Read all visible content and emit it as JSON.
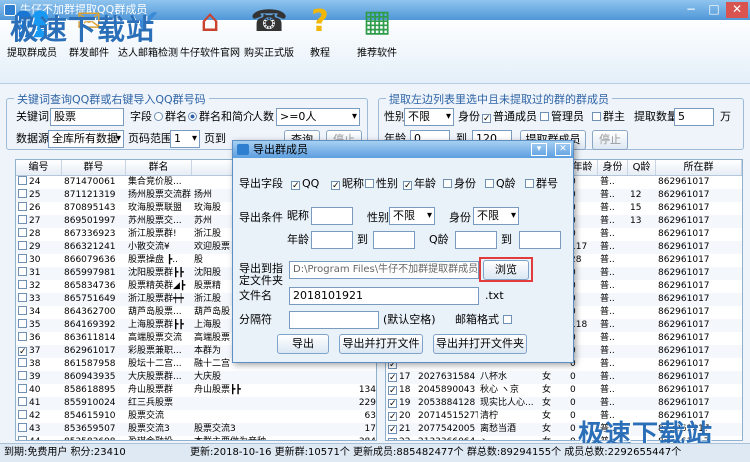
{
  "window": {
    "title": "牛仔不加群提取QQ群成员",
    "min": "−",
    "max": "□",
    "close": "✕"
  },
  "toolbar": {
    "items": [
      {
        "label": "提取群成员",
        "icon": "people-icon"
      },
      {
        "label": "群发邮件",
        "icon": "mail-icon"
      },
      {
        "label": "达人邮箱检测",
        "icon": "mail-check-icon"
      },
      {
        "label": "牛仔软件官网",
        "icon": "home-icon"
      },
      {
        "label": "购买正式版",
        "icon": "headset-icon"
      },
      {
        "label": "教程",
        "icon": "help-icon"
      },
      {
        "label": "推荐软件",
        "icon": "grid-icon"
      }
    ],
    "watermark": "极速下载站"
  },
  "search": {
    "title": "关键词查询QQ群或右键导入QQ群号码",
    "keyword_label": "关键词",
    "keyword_value": "股票",
    "field_label": "字段",
    "opt_name": "群名",
    "opt_name_intro": "群名和简介",
    "members_label": "人数",
    "members_value": ">=0人",
    "source_label": "数据源",
    "source_value": "全库所有数据",
    "page_label": "页码范围",
    "page_from": "1",
    "page_to_label": "页到",
    "search_btn": "查询",
    "stop_btn": "停止"
  },
  "extract": {
    "title": "提取左边列表里选中且未提取过的群的群成员",
    "gender_label": "性别",
    "gender_value": "不限",
    "identity_label": "身份",
    "normal": "普通成员",
    "admin": "管理员",
    "owner": "群主",
    "count_label": "提取数量",
    "count_value": "5",
    "unit": "万",
    "age_label": "年龄",
    "age_from": "0",
    "age_to_label": "到",
    "age_to": "120",
    "start_btn": "提取群成员",
    "stop_btn": "停止"
  },
  "left_table": {
    "headers": [
      "编号",
      "群号",
      "群名",
      "",
      "人数"
    ],
    "rows": [
      {
        "no": "24",
        "id": "871470061",
        "name": "集合竞价股...",
        "name2": "",
        "n": ""
      },
      {
        "no": "25",
        "id": "871121319",
        "name": "扬州股票交流群",
        "name2": "扬州",
        "n": ""
      },
      {
        "no": "26",
        "id": "870895143",
        "name": "玫海股票联盟",
        "name2": "玫海股",
        "n": ""
      },
      {
        "no": "27",
        "id": "869501997",
        "name": "苏州股票交...",
        "name2": "苏州",
        "n": ""
      },
      {
        "no": "28",
        "id": "867336923",
        "name": "浙江股票群!",
        "name2": "浙江股",
        "n": ""
      },
      {
        "no": "29",
        "id": "866321241",
        "name": "小散交流¥",
        "name2": "欢迎股票",
        "n": ""
      },
      {
        "no": "30",
        "id": "866079636",
        "name": "股票操盘 ┣..",
        "name2": "股",
        "n": ""
      },
      {
        "no": "31",
        "id": "865997981",
        "name": "沈阳股票群┣┣",
        "name2": "沈阳股",
        "n": ""
      },
      {
        "no": "32",
        "id": "865834736",
        "name": "股票精英群◢┣",
        "name2": "股票精",
        "n": ""
      },
      {
        "no": "33",
        "id": "865751649",
        "name": "浙江股票群┿┿",
        "name2": "浙江股",
        "n": ""
      },
      {
        "no": "34",
        "id": "864362700",
        "name": "葫芦岛股票...",
        "name2": "葫芦岛股",
        "n": ""
      },
      {
        "no": "35",
        "id": "864169392",
        "name": "上海股票群┣┣",
        "name2": "上海股",
        "n": ""
      },
      {
        "no": "36",
        "id": "863611814",
        "name": "高端股票交流",
        "name2": "高端股票",
        "n": ""
      },
      {
        "no": "37",
        "id": "862961017",
        "name": "彩股票兼职...",
        "name2": "本群为",
        "n": "",
        "checked": true
      },
      {
        "no": "38",
        "id": "861587958",
        "name": "股坛十二宫...",
        "name2": "融十二宫",
        "n": ""
      },
      {
        "no": "39",
        "id": "860943935",
        "name": "大庆股票群...",
        "name2": "大庆股",
        "n": ""
      },
      {
        "no": "40",
        "id": "858618895",
        "name": "舟山股票群",
        "name2": "舟山股票┣┣",
        "n": "134"
      },
      {
        "no": "41",
        "id": "855910024",
        "name": "红三兵股票",
        "name2": "",
        "n": "229"
      },
      {
        "no": "42",
        "id": "854615910",
        "name": "股票交流",
        "name2": "",
        "n": "63"
      },
      {
        "no": "43",
        "id": "853659507",
        "name": "股票交流3",
        "name2": "股票交流3",
        "n": "17"
      },
      {
        "no": "44",
        "id": "852583698",
        "name": "盈琪金融投...",
        "name2": "本群主要做为音种...",
        "n": "384"
      },
      {
        "no": "45",
        "id": "852333477",
        "name": "股票散户集...",
        "name2": "",
        "n": "88"
      }
    ]
  },
  "right_table": {
    "headers": [
      "",
      "QQ",
      "昵称",
      "性别",
      "年龄",
      "身份",
      "Q龄",
      "所在群"
    ],
    "rows": [
      {
        "no": "",
        "qq": "",
        "nick": "",
        "sex": "",
        "age": "0",
        "role": "普..",
        "ql": "",
        "grp": "862961017"
      },
      {
        "no": "",
        "qq": "",
        "nick": "",
        "sex": "",
        "age": "0",
        "role": "普..",
        "ql": "12",
        "grp": "862961017"
      },
      {
        "no": "",
        "qq": "",
        "nick": "",
        "sex": "",
        "age": "0",
        "role": "普..",
        "ql": "15",
        "grp": "862961017"
      },
      {
        "no": "",
        "qq": "",
        "nick": "",
        "sex": "",
        "age": "0",
        "role": "普..",
        "ql": "13",
        "grp": "862961017"
      },
      {
        "no": "",
        "qq": "",
        "nick": "",
        "sex": "",
        "age": "0",
        "role": "普..",
        "ql": "",
        "grp": "862961017"
      },
      {
        "no": "",
        "qq": "",
        "nick": "",
        "sex": "",
        "age": "117",
        "role": "普..",
        "ql": "",
        "grp": "862961017"
      },
      {
        "no": "",
        "qq": "",
        "nick": "",
        "sex": "",
        "age": "28",
        "role": "普..",
        "ql": "",
        "grp": "862961017"
      },
      {
        "no": "",
        "qq": "",
        "nick": "",
        "sex": "",
        "age": "0",
        "role": "普..",
        "ql": "",
        "grp": "862961017"
      },
      {
        "no": "",
        "qq": "",
        "nick": "",
        "sex": "",
        "age": "0",
        "role": "普..",
        "ql": "",
        "grp": "862961017"
      },
      {
        "no": "",
        "qq": "",
        "nick": "",
        "sex": "",
        "age": "0",
        "role": "普..",
        "ql": "",
        "grp": "862961017"
      },
      {
        "no": "",
        "qq": "",
        "nick": "",
        "sex": "",
        "age": "0",
        "role": "普..",
        "ql": "",
        "grp": "862961017"
      },
      {
        "no": "",
        "qq": "",
        "nick": "",
        "sex": "",
        "age": "118",
        "role": "普..",
        "ql": "",
        "grp": "862961017"
      },
      {
        "no": "",
        "qq": "",
        "nick": "",
        "sex": "",
        "age": "0",
        "role": "普..",
        "ql": "",
        "grp": "862961017"
      },
      {
        "no": "",
        "qq": "",
        "nick": "",
        "sex": "",
        "age": "0",
        "role": "普..",
        "ql": "",
        "grp": "862961017"
      },
      {
        "no": "",
        "qq": "",
        "nick": "",
        "sex": "",
        "age": "0",
        "role": "普..",
        "ql": "",
        "grp": "862961017"
      },
      {
        "no": "17",
        "qq": "2027631584",
        "nick": "八杯水",
        "sex": "女",
        "age": "0",
        "role": "普..",
        "ql": "",
        "grp": "862961017"
      },
      {
        "no": "18",
        "qq": "2045890043",
        "nick": "秋心 ヽ京",
        "sex": "女",
        "age": "0",
        "role": "普..",
        "ql": "",
        "grp": "862961017"
      },
      {
        "no": "19",
        "qq": "2053884128",
        "nick": "现实比人心...",
        "sex": "女",
        "age": "0",
        "role": "普..",
        "ql": "",
        "grp": "862961017"
      },
      {
        "no": "20",
        "qq": "2071451527T",
        "nick": "清柠",
        "sex": "女",
        "age": "0",
        "role": "普..",
        "ql": "",
        "grp": "862961017"
      },
      {
        "no": "21",
        "qq": "2077542005",
        "nick": "离愁当酒",
        "sex": "女",
        "age": "0",
        "role": "普..",
        "ql": "",
        "grp": "862961017"
      },
      {
        "no": "22",
        "qq": "2133366064",
        "nick": "丶...",
        "sex": "女",
        "age": "0",
        "role": "普..",
        "ql": "",
        "grp": "862961017"
      }
    ]
  },
  "dialog": {
    "title": "导出群成员",
    "fields_label": "导出字段",
    "f_qq": "QQ",
    "f_nick": "昵称",
    "f_sex": "性别",
    "f_age": "年龄",
    "f_role": "身份",
    "f_ql": "Q龄",
    "f_grp": "群号",
    "cond_label": "导出条件",
    "nick_label": "昵称",
    "sex_label": "性别",
    "sex_value": "不限",
    "role_label": "身份",
    "role_value": "不限",
    "age_label": "年龄",
    "to1": "到",
    "ql_label": "Q龄",
    "to2": "到",
    "path_label": "导出到指定文件夹",
    "path_value": "D:\\Program Files\\牛仔不加群提取群成员\\",
    "browse": "浏览",
    "filename_label": "文件名",
    "filename_value": "2018101921",
    "ext": ".txt",
    "sep_label": "分隔符",
    "sep_hint": "(默认空格)",
    "mail_label": "邮箱格式",
    "btn_export": "导出",
    "btn_export_open_file": "导出并打开文件",
    "btn_export_open_folder": "导出并打开文件夹"
  },
  "status": {
    "text": "到期:免费用户 积分:23410",
    "update": "更新:2018-10-16 更新群:10571个 更新成员:885482477个 群总数:89294155个 成员总数:2292655447个"
  },
  "colors": {
    "accent": "#2f64a6",
    "highlight": "#e23b3b"
  }
}
